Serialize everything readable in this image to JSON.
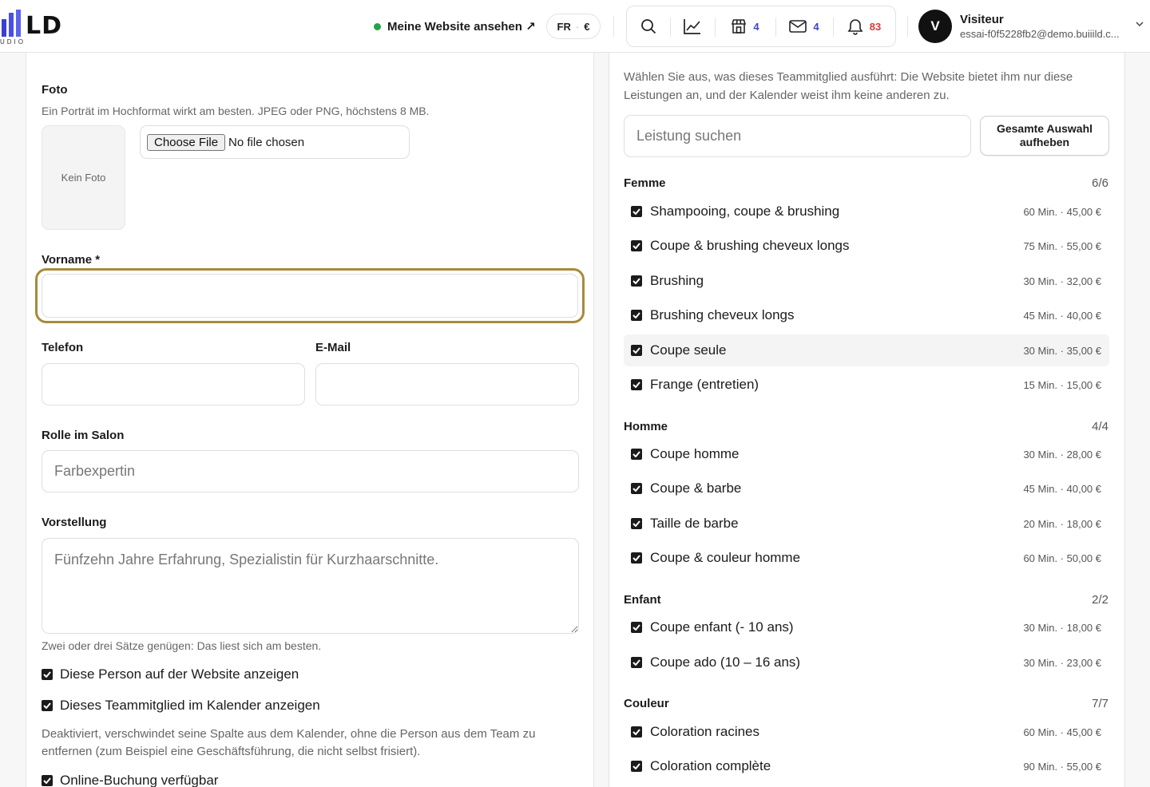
{
  "header": {
    "logo_text": "LD",
    "logo_sub": "UDIO",
    "site_link": "Meine Website ansehen ↗",
    "lang": "FR",
    "currency": "€",
    "badges": {
      "shop": "4",
      "mail": "4",
      "bell": "83"
    },
    "user": {
      "initial": "V",
      "name": "Visiteur",
      "email": "essai-f0f5228fb2@demo.buiiild.c..."
    },
    "colors": {
      "online": "#22a347",
      "badge_blue": "#3f46c9",
      "badge_red": "#d93b3b"
    }
  },
  "form": {
    "photo": {
      "label": "Foto",
      "hint": "Ein Porträt im Hochformat wirkt am besten. JPEG oder PNG, höchstens 8 MB.",
      "placeholder": "Kein Foto",
      "file_button": "Choose File",
      "file_status": "No file chosen"
    },
    "firstname": {
      "label": "Vorname *",
      "value": ""
    },
    "phone": {
      "label": "Telefon",
      "value": ""
    },
    "email": {
      "label": "E-Mail",
      "value": ""
    },
    "role": {
      "label": "Rolle im Salon",
      "placeholder": "Farbexpertin"
    },
    "intro": {
      "label": "Vorstellung",
      "placeholder": "Fünfzehn Jahre Erfahrung, Spezialistin für Kurzhaarschnitte.",
      "hint": "Zwei oder drei Sätze genügen: Das liest sich am besten."
    },
    "checkboxes": {
      "website": "Diese Person auf der Website anzeigen",
      "calendar": "Dieses Teammitglied im Kalender anzeigen",
      "calendar_hint": "Deaktiviert, verschwindet seine Spalte aus dem Kalender, ohne die Person aus dem Team zu entfernen (zum Beispiel eine Geschäftsführung, die nicht selbst frisiert).",
      "booking": "Online-Buchung verfügbar"
    },
    "focus_color": "#a88a3c"
  },
  "services": {
    "intro": "Wählen Sie aus, was dieses Teammitglied ausführt: Die Website bietet ihm nur diese Leistungen an, und der Kalender weist ihm keine anderen zu.",
    "search_placeholder": "Leistung suchen",
    "clear_button": "Gesamte Auswahl aufheben",
    "groups": [
      {
        "title": "Femme",
        "count": "6/6",
        "items": [
          {
            "name": "Shampooing, coupe & brushing",
            "meta": "60 Min. · 45,00 €"
          },
          {
            "name": "Coupe & brushing cheveux longs",
            "meta": "75 Min. · 55,00 €"
          },
          {
            "name": "Brushing",
            "meta": "30 Min. · 32,00 €"
          },
          {
            "name": "Brushing cheveux longs",
            "meta": "45 Min. · 40,00 €"
          },
          {
            "name": "Coupe seule",
            "meta": "30 Min. · 35,00 €"
          },
          {
            "name": "Frange (entretien)",
            "meta": "15 Min. · 15,00 €"
          }
        ]
      },
      {
        "title": "Homme",
        "count": "4/4",
        "items": [
          {
            "name": "Coupe homme",
            "meta": "30 Min. · 28,00 €"
          },
          {
            "name": "Coupe & barbe",
            "meta": "45 Min. · 40,00 €"
          },
          {
            "name": "Taille de barbe",
            "meta": "20 Min. · 18,00 €"
          },
          {
            "name": "Coupe & couleur homme",
            "meta": "60 Min. · 50,00 €"
          }
        ]
      },
      {
        "title": "Enfant",
        "count": "2/2",
        "items": [
          {
            "name": "Coupe enfant (- 10 ans)",
            "meta": "30 Min. · 18,00 €"
          },
          {
            "name": "Coupe ado (10 – 16 ans)",
            "meta": "30 Min. · 23,00 €"
          }
        ]
      },
      {
        "title": "Couleur",
        "count": "7/7",
        "items": [
          {
            "name": "Coloration racines",
            "meta": "60 Min. · 45,00 €"
          },
          {
            "name": "Coloration complète",
            "meta": "90 Min. · 55,00 €"
          }
        ]
      }
    ]
  }
}
